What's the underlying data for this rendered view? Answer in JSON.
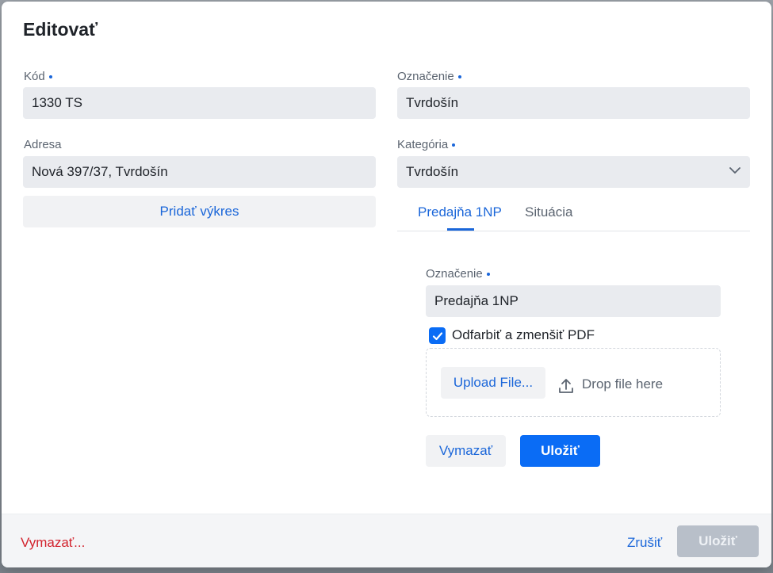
{
  "dialog": {
    "title": "Editovať"
  },
  "form": {
    "kod": {
      "label": "Kód",
      "value": "1330 TS"
    },
    "oznacenie": {
      "label": "Označenie",
      "value": "Tvrdošín"
    },
    "adresa": {
      "label": "Adresa",
      "value": "Nová 397/37, Tvrdošín"
    },
    "kategoria": {
      "label": "Kategória",
      "value": "Tvrdošín"
    },
    "add_drawing_label": "Pridať výkres"
  },
  "tabs": [
    {
      "label": "Predajňa 1NP",
      "active": true
    },
    {
      "label": "Situácia",
      "active": false
    }
  ],
  "drawing": {
    "oznacenie": {
      "label": "Označenie",
      "value": "Predajňa 1NP"
    },
    "checkbox": {
      "label": "Odfarbiť a zmenšiť PDF",
      "checked": true
    },
    "upload_label": "Upload File...",
    "drop_label": "Drop file here",
    "delete_label": "Vymazať",
    "save_label": "Uložiť"
  },
  "footer": {
    "delete_label": "Vymazať...",
    "cancel_label": "Zrušiť",
    "save_label": "Uložiť"
  },
  "icons": {
    "required": "required-dot-icon",
    "chevron": "chevron-down-icon",
    "check": "checkmark-icon",
    "upload": "upload-icon"
  },
  "colors": {
    "accent": "#1a66d9",
    "primary_button": "#0a6cf5",
    "danger": "#d2222d",
    "disabled_button": "#b8bfc9"
  }
}
